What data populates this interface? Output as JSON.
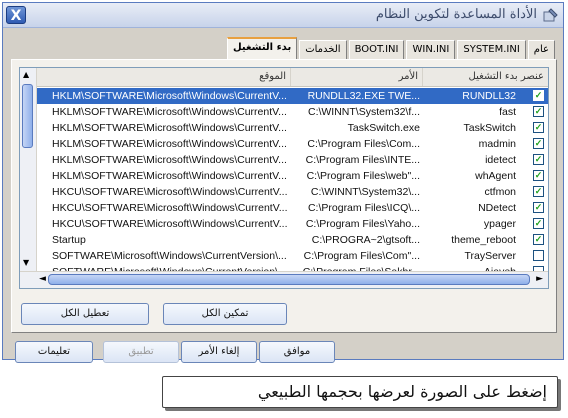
{
  "window": {
    "title": "الأداة المساعدة لتكوين النظام",
    "close_label": "X"
  },
  "tabs": [
    {
      "label": "عام",
      "active": false
    },
    {
      "label": "SYSTEM.INI",
      "active": false
    },
    {
      "label": "WIN.INI",
      "active": false
    },
    {
      "label": "BOOT.INI",
      "active": false
    },
    {
      "label": "الخدمات",
      "active": false
    },
    {
      "label": "بدء التشغيل",
      "active": true
    }
  ],
  "list": {
    "headers": {
      "name": "عنصر بدء التشغيل",
      "command": "الأمر",
      "location": "الموقع"
    },
    "rows": [
      {
        "checked": true,
        "name": "RUNDLL32",
        "command": "RUNDLL32.EXE TWE...",
        "location": "HKLM\\SOFTWARE\\Microsoft\\Windows\\CurrentV...",
        "selected": true
      },
      {
        "checked": true,
        "name": "fast",
        "command": "C:\\WINNT\\System32\\f...",
        "location": "HKLM\\SOFTWARE\\Microsoft\\Windows\\CurrentV...",
        "selected": false
      },
      {
        "checked": true,
        "name": "TaskSwitch",
        "command": "TaskSwitch.exe",
        "location": "HKLM\\SOFTWARE\\Microsoft\\Windows\\CurrentV...",
        "selected": false
      },
      {
        "checked": true,
        "name": "madmin",
        "command": "C:\\Program Files\\Com...",
        "location": "HKLM\\SOFTWARE\\Microsoft\\Windows\\CurrentV...",
        "selected": false
      },
      {
        "checked": true,
        "name": "idetect",
        "command": "C:\\Program Files\\INTE...",
        "location": "HKLM\\SOFTWARE\\Microsoft\\Windows\\CurrentV...",
        "selected": false
      },
      {
        "checked": true,
        "name": "whAgent",
        "command": "C:\\Program Files\\web\"...",
        "location": "HKLM\\SOFTWARE\\Microsoft\\Windows\\CurrentV...",
        "selected": false
      },
      {
        "checked": true,
        "name": "ctfmon",
        "command": "C:\\WINNT\\System32\\...",
        "location": "HKCU\\SOFTWARE\\Microsoft\\Windows\\CurrentV...",
        "selected": false
      },
      {
        "checked": true,
        "name": "NDetect",
        "command": "C:\\Program Files\\ICQ\\...",
        "location": "HKCU\\SOFTWARE\\Microsoft\\Windows\\CurrentV...",
        "selected": false
      },
      {
        "checked": true,
        "name": "ypager",
        "command": "C:\\Program Files\\Yaho...",
        "location": "HKCU\\SOFTWARE\\Microsoft\\Windows\\CurrentV...",
        "selected": false
      },
      {
        "checked": true,
        "name": "theme_reboot",
        "command": "C:\\PROGRA~2\\gtsoft...",
        "location": "Startup",
        "selected": false
      },
      {
        "checked": false,
        "name": "TrayServer",
        "command": "C:\\Program Files\\Com\"...",
        "location": "SOFTWARE\\Microsoft\\Windows\\CurrentVersion\\...",
        "selected": false
      },
      {
        "checked": false,
        "name": "Ajaveb",
        "command": "C:\\Program Files\\Sakhr...",
        "location": "SOFTWARE\\Microsoft\\Windows\\CurrentVersion\\...",
        "selected": false
      }
    ]
  },
  "panel_buttons": {
    "enable_all": "تمكين الكل",
    "disable_all": "تعطيل الكل"
  },
  "dialog_buttons": {
    "ok": "موافق",
    "cancel": "إلغاء الأمر",
    "apply": "تطبيق",
    "help": "تعليمات"
  },
  "caption": "إضغط على الصورة لعرضها بحجمها الطبيعي"
}
